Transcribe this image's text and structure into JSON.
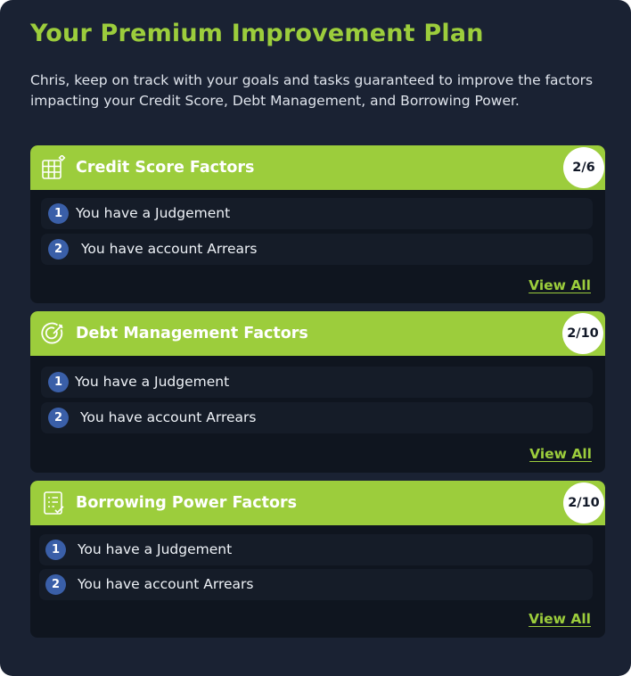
{
  "title": "Your Premium Improvement Plan",
  "intro": "Chris, keep on track with your goals and tasks guaranteed to improve the factors impacting your Credit Score, Debt Management, and Borrowing Power.",
  "colors": {
    "panel_background": "#1a2233",
    "accent_green": "#9ccd3c",
    "card_background": "#0f151f",
    "item_background": "#151c28",
    "number_circle": "#3a5fa8"
  },
  "cards": [
    {
      "title": "Credit Score Factors",
      "icon": "grid-table-icon",
      "count": "2/6",
      "items": [
        {
          "number": "1",
          "text": "You have a Judgement"
        },
        {
          "number": "2",
          "text": "You have account Arrears"
        }
      ],
      "link": "View All"
    },
    {
      "title": "Debt Management Factors",
      "icon": "target-icon",
      "count": "2/10",
      "items": [
        {
          "number": "1",
          "text": "You have a Judgement"
        },
        {
          "number": "2",
          "text": "You have account Arrears"
        }
      ],
      "link": "View All"
    },
    {
      "title": "Borrowing Power Factors",
      "icon": "checklist-icon",
      "count": "2/10",
      "items": [
        {
          "number": "1",
          "text": "You have a Judgement"
        },
        {
          "number": "2",
          "text": "You have account Arrears"
        }
      ],
      "link": "View All"
    }
  ]
}
